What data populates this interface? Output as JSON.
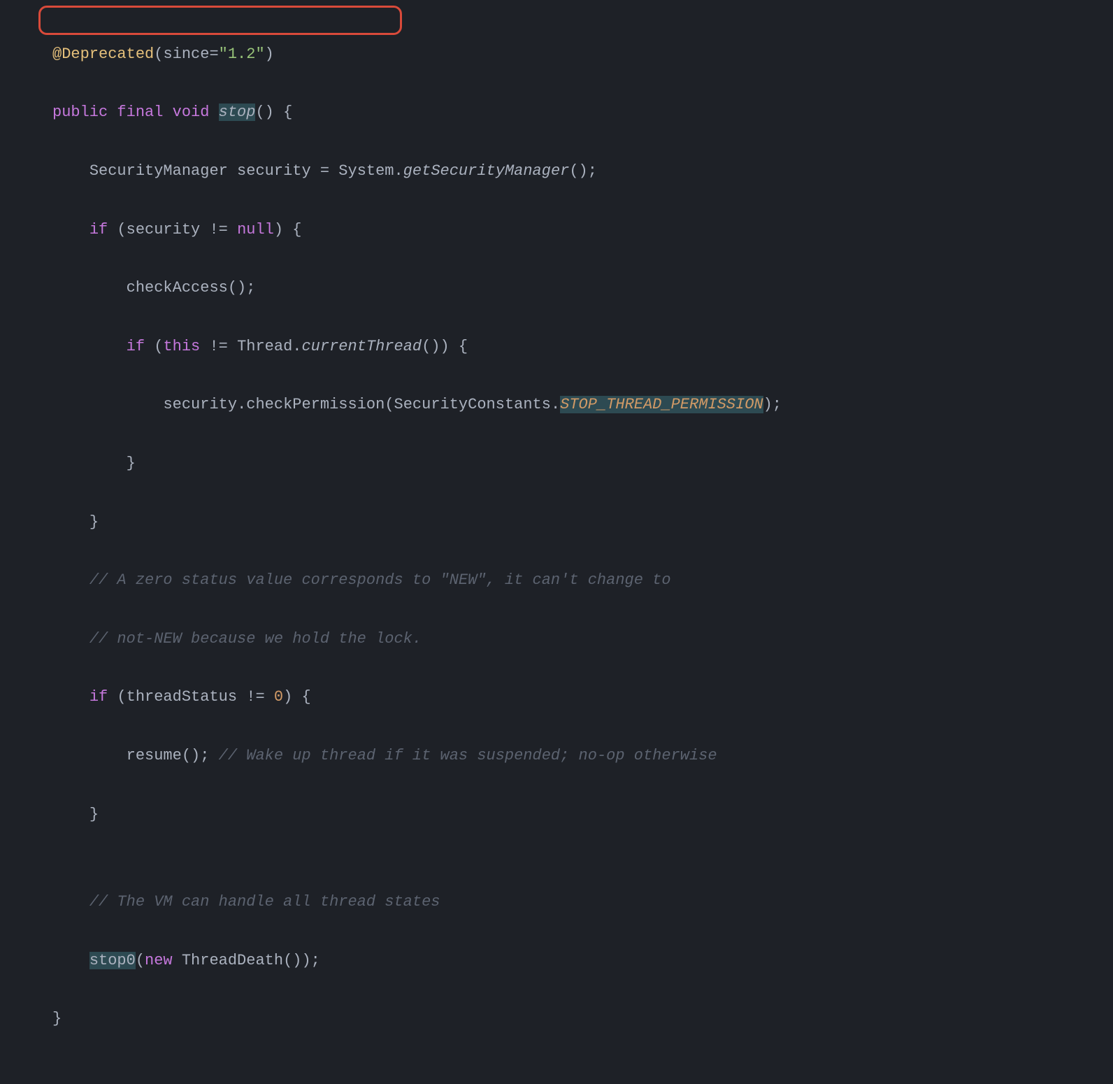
{
  "code": {
    "line1": {
      "annotation": "@Deprecated",
      "lparen": "(",
      "param": "since=",
      "value": "\"1.2\"",
      "rparen": ")"
    },
    "line2": {
      "kw_public": "public",
      "kw_final": "final",
      "kw_void": "void",
      "method": "stop",
      "parens": "()",
      "brace": " {"
    },
    "line3": {
      "indent": "    ",
      "type": "SecurityManager",
      "var": " security ",
      "eq": "=",
      "sys": " System",
      "dot": ".",
      "call": "getSecurityManager",
      "tail": "();"
    },
    "line4": {
      "indent": "    ",
      "kw_if": "if",
      "lparen": " (",
      "var": "security ",
      "op": "!=",
      "sp": " ",
      "kw_null": "null",
      "rparen": ")",
      "brace": " {"
    },
    "line5": {
      "indent": "        ",
      "call": "checkAccess();"
    },
    "line6": {
      "indent": "        ",
      "kw_if": "if",
      "lparen": " (",
      "kw_this": "this",
      "op": " != ",
      "cls": "Thread",
      "dot": ".",
      "call": "currentThread",
      "tail": "())",
      "brace": " {"
    },
    "line7": {
      "indent": "            ",
      "var": "security",
      "dot1": ".",
      "call": "checkPermission",
      "lparen": "(",
      "cls": "SecurityConstants",
      "dot2": ".",
      "const": "STOP_THREAD_PERMISSION",
      "rparen": ");"
    },
    "line8": {
      "indent": "        ",
      "brace": "}"
    },
    "line9": {
      "indent": "    ",
      "brace": "}"
    },
    "line10": {
      "indent": "    ",
      "comment": "// A zero status value corresponds to \"NEW\", it can't change to"
    },
    "line11": {
      "indent": "    ",
      "comment": "// not-NEW because we hold the lock."
    },
    "line12": {
      "indent": "    ",
      "kw_if": "if",
      "lparen": " (",
      "var": "threadStatus ",
      "op": "!=",
      "sp": " ",
      "num": "0",
      "rparen": ")",
      "brace": " {"
    },
    "line13": {
      "indent": "        ",
      "call": "resume(); ",
      "comment": "// Wake up thread if it was suspended; no-op otherwise"
    },
    "line14": {
      "indent": "    ",
      "brace": "}"
    },
    "line15": "",
    "line16": {
      "indent": "    ",
      "comment": "// The VM can handle all thread states"
    },
    "line17": {
      "indent": "    ",
      "call": "stop0",
      "lparen": "(",
      "kw_new": "new",
      "sp": " ",
      "cls": "ThreadDeath",
      "tail": "());"
    },
    "line18": {
      "brace": "}"
    }
  }
}
